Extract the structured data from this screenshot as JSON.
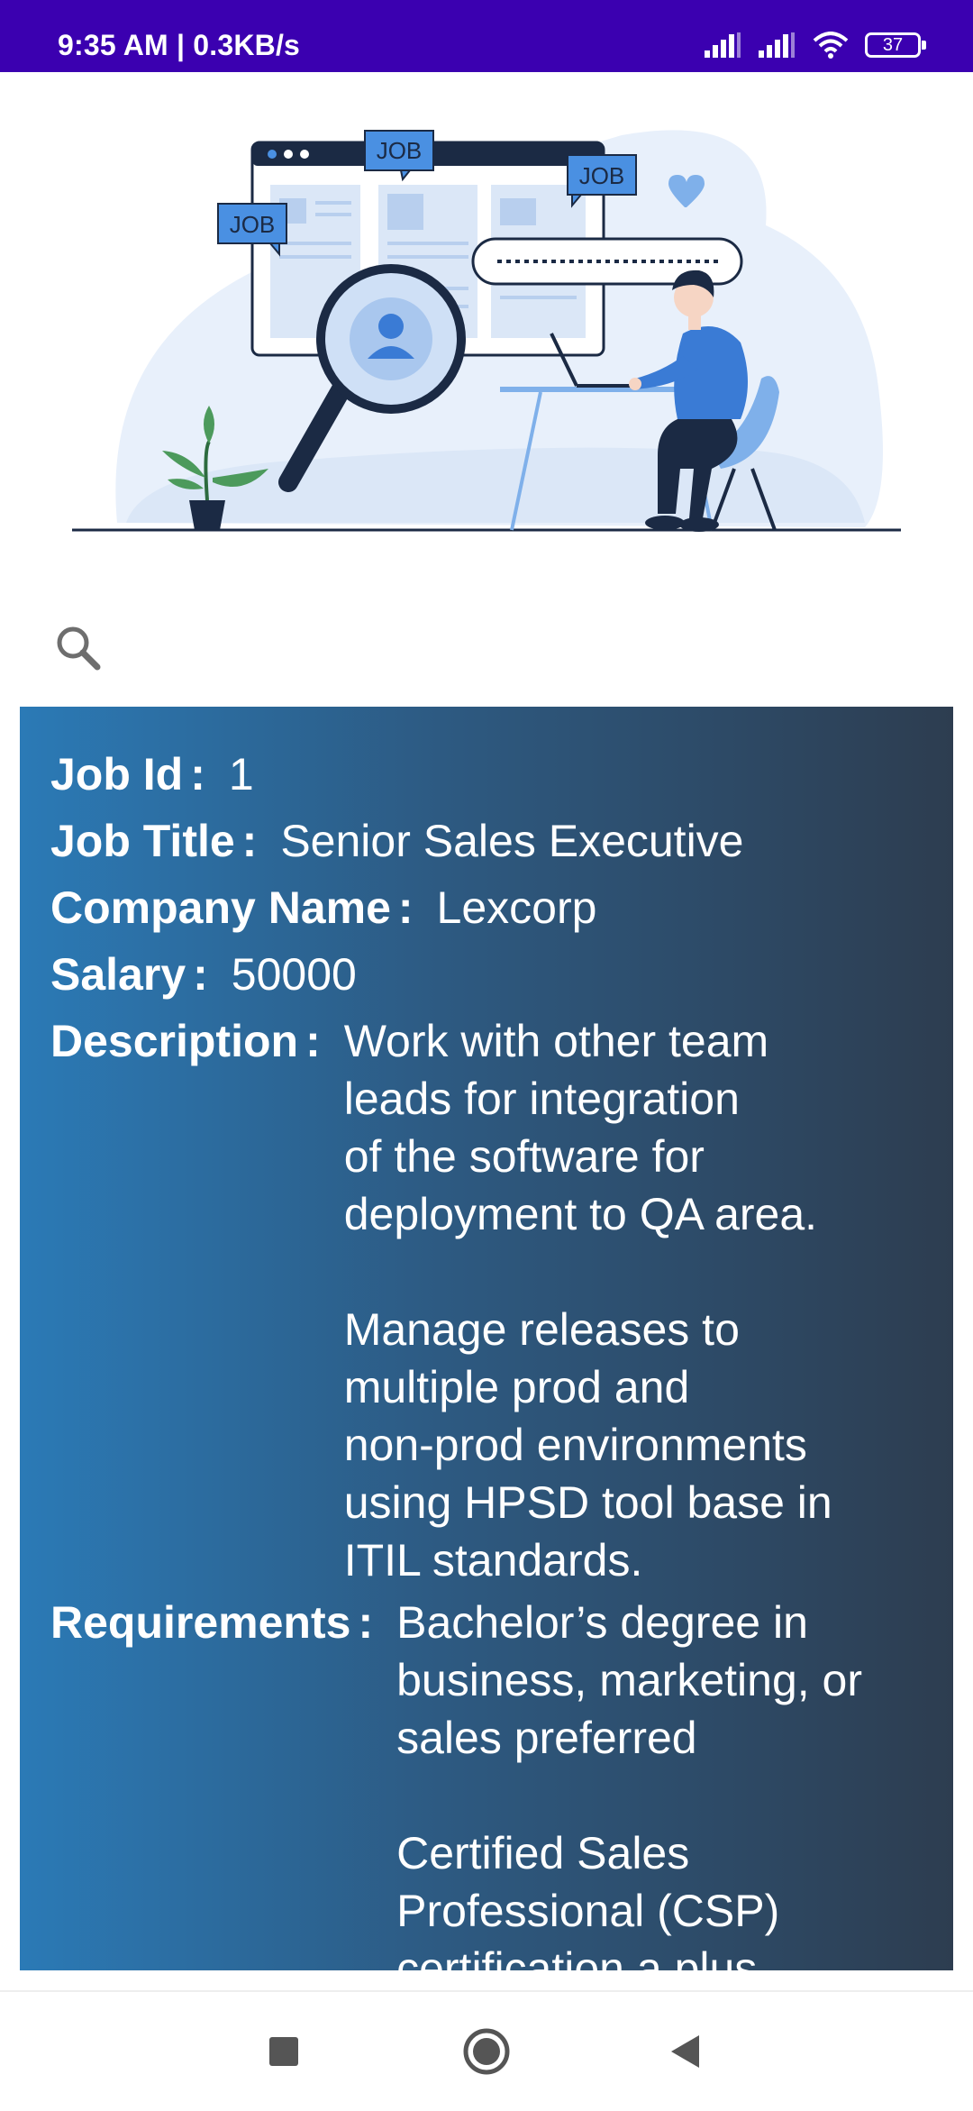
{
  "status_bar": {
    "time": "9:35 AM | 0.3KB/s",
    "battery": "37"
  },
  "hero": {
    "tags": [
      "JOB",
      "JOB",
      "JOB"
    ]
  },
  "search": {
    "icon": "search-icon"
  },
  "job": {
    "id_label": "Job Id",
    "id": "1",
    "title_label": "Job Title",
    "title": "Senior Sales Executive",
    "company_label": "Company Name",
    "company": "Lexcorp",
    "salary_label": "Salary",
    "salary": "50000",
    "description_label": "Description",
    "description": "Work with other team\nleads for integration\nof the software for\ndeployment to QA area.\n\nManage releases to\nmultiple prod and\nnon-prod environments\nusing HPSD tool base in\nITIL standards.",
    "requirements_label": "Requirements",
    "requirements": "Bachelor’s degree in\nbusiness, marketing, or\nsales preferred\n\nCertified Sales\nProfessional (CSP)\ncertification a plus"
  },
  "colors": {
    "status_bar": "#3b00b0",
    "card_start": "#2b7ab6",
    "card_end": "#2d3d50"
  },
  "nav": {
    "recents": "square-icon",
    "home": "circle-icon",
    "back": "triangle-back-icon"
  }
}
